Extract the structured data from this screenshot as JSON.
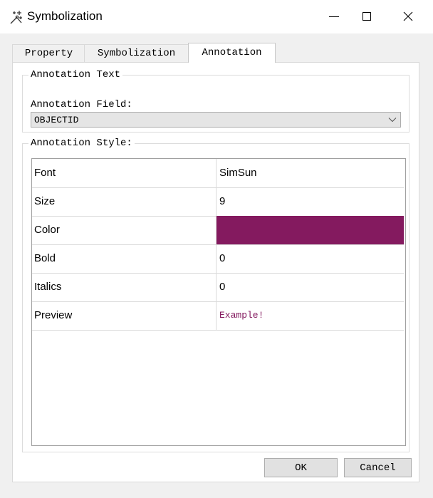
{
  "window": {
    "title": "Symbolization",
    "app_icon": "magic-wand-icon"
  },
  "tabs": [
    {
      "label": "Property",
      "active": false
    },
    {
      "label": "Symbolization",
      "active": false
    },
    {
      "label": "Annotation",
      "active": true
    }
  ],
  "annotation_text": {
    "group_label": "Annotation Text",
    "field_label": "Annotation Field:",
    "field_value": "OBJECTID"
  },
  "annotation_style": {
    "group_label": "Annotation Style:",
    "rows": [
      {
        "key": "Font",
        "value": "SimSun"
      },
      {
        "key": "Size",
        "value": "9"
      },
      {
        "key": "Color",
        "value": ""
      },
      {
        "key": "Bold",
        "value": "0"
      },
      {
        "key": "Italics",
        "value": "0"
      },
      {
        "key": "Preview",
        "value": "Example!"
      }
    ],
    "color_hex": "#841a5f"
  },
  "buttons": {
    "ok": "OK",
    "cancel": "Cancel"
  }
}
